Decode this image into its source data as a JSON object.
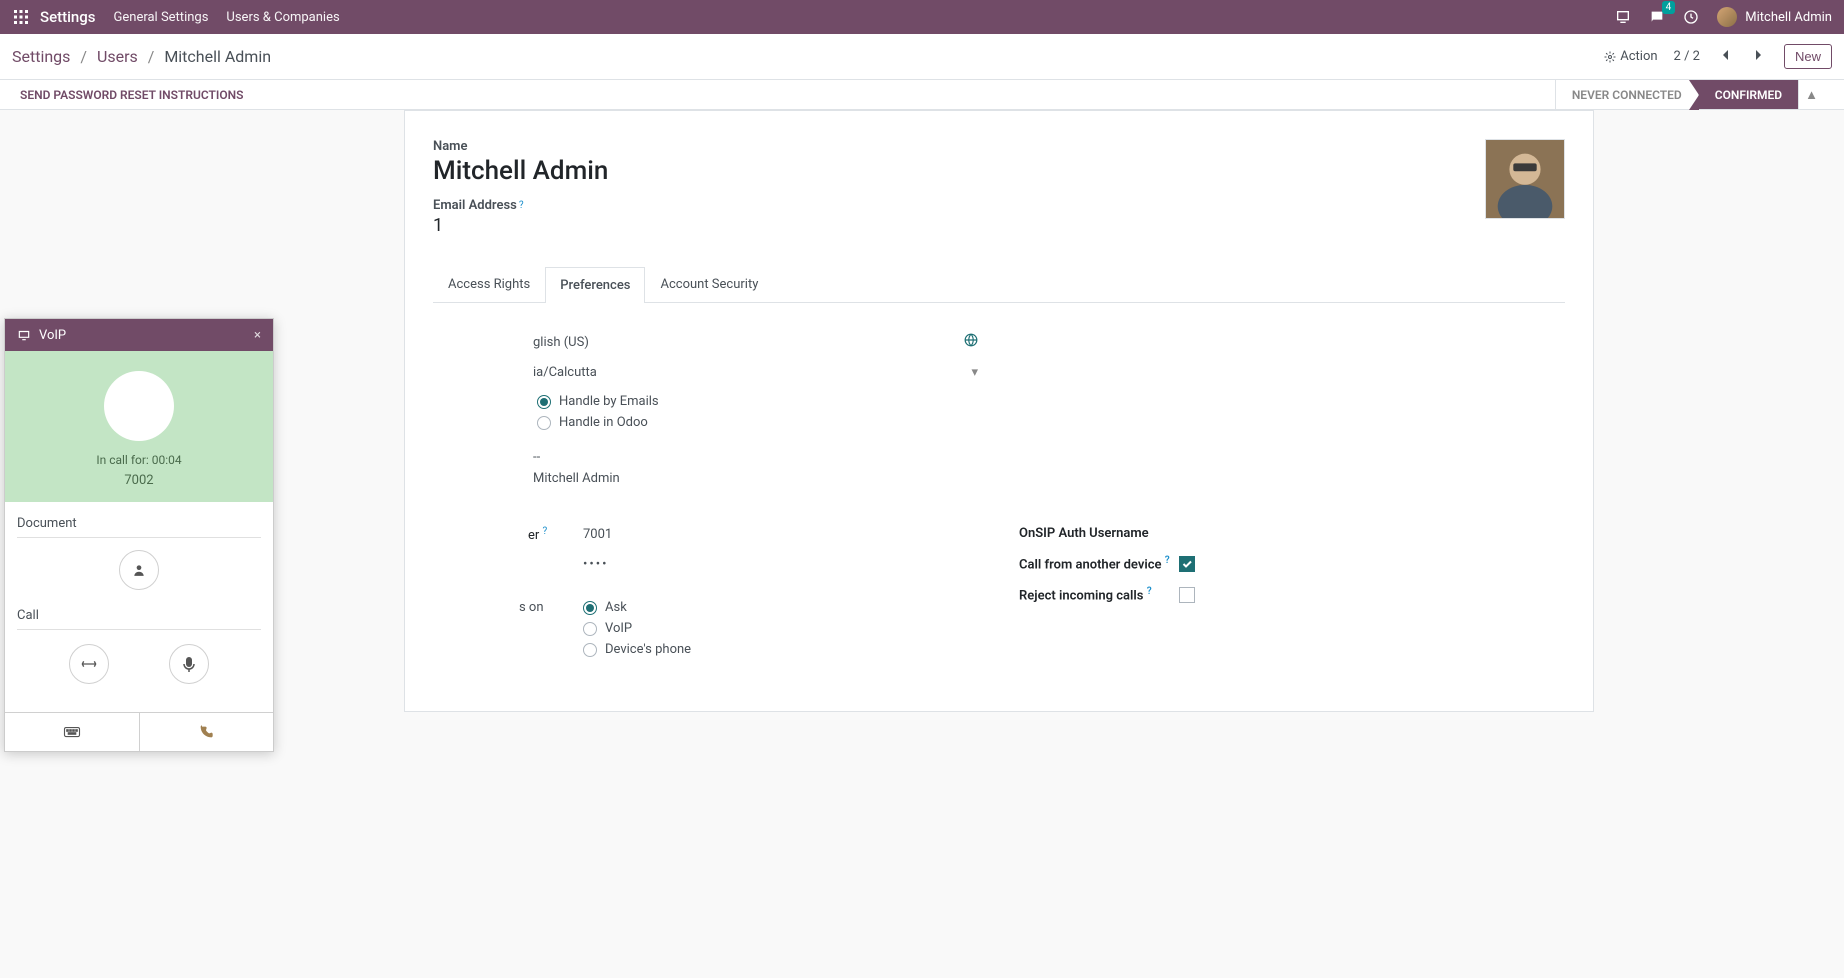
{
  "navbar": {
    "app_title": "Settings",
    "menu": [
      "General Settings",
      "Users & Companies"
    ],
    "msg_count": "4",
    "user_name": "Mitchell Admin"
  },
  "breadcrumb": {
    "parts": [
      "Settings",
      "Users"
    ],
    "current": "Mitchell Admin"
  },
  "controls": {
    "action_label": "Action",
    "pager": "2 / 2",
    "new_label": "New"
  },
  "statusbar": {
    "pwd_reset": "SEND PASSWORD RESET INSTRUCTIONS",
    "statuses": [
      "NEVER CONNECTED",
      "CONFIRMED"
    ],
    "active_status": 1
  },
  "form": {
    "name_label": "Name",
    "name_value": "Mitchell Admin",
    "email_label": "Email Address",
    "email_value": "1",
    "tabs": [
      "Access Rights",
      "Preferences",
      "Account Security"
    ],
    "active_tab": 1,
    "language_value": "glish (US)",
    "timezone_value": "ia/Calcutta",
    "notification": {
      "options": [
        "Handle by Emails",
        "Handle in Odoo"
      ],
      "selected": 0
    },
    "dash_value": "--",
    "signature_value": "Mitchell Admin",
    "voip": {
      "er_label": "er",
      "username_value": "7001",
      "secret_value": "••••",
      "onsip_label": "OnSIP Auth Username",
      "other_device_label": "Call from another device",
      "other_device_checked": true,
      "reject_label": "Reject incoming calls",
      "reject_checked": false,
      "son_label": "s on",
      "call_on": {
        "options": [
          "Ask",
          "VoIP",
          "Device's phone"
        ],
        "selected": 0
      }
    }
  },
  "voip_popup": {
    "title": "VoIP",
    "in_call": "In call for: 00:04",
    "number": "7002",
    "doc_label": "Document",
    "call_label": "Call"
  }
}
